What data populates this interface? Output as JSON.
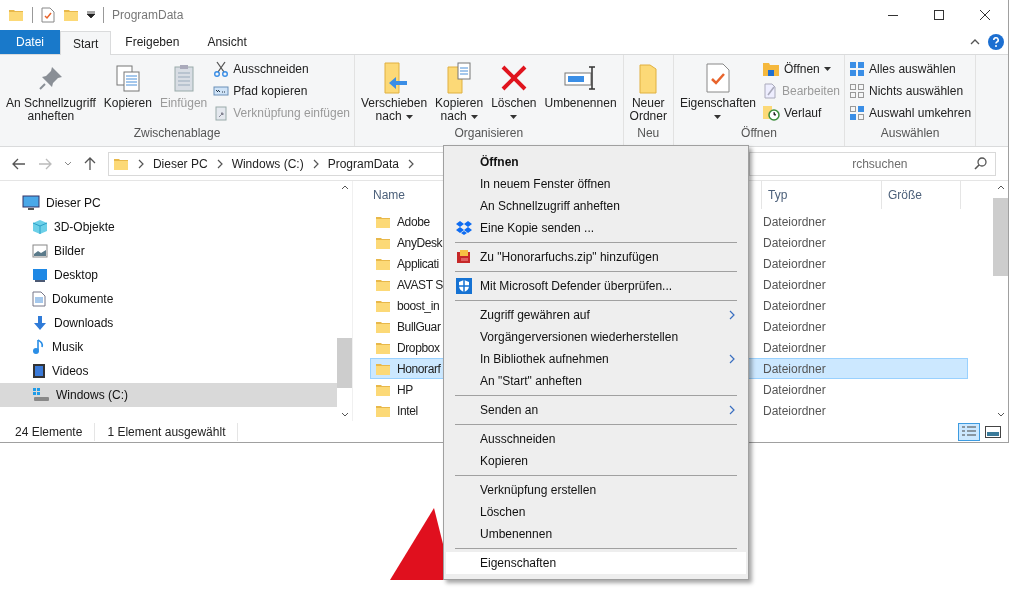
{
  "window": {
    "title": "ProgramData"
  },
  "ribbon_tabs": [
    {
      "label": "Datei",
      "selected": false,
      "kind": "file"
    },
    {
      "label": "Start",
      "selected": true,
      "kind": "tab"
    },
    {
      "label": "Freigeben",
      "selected": false,
      "kind": "tab"
    },
    {
      "label": "Ansicht",
      "selected": false,
      "kind": "tab"
    }
  ],
  "ribbon_groups": [
    {
      "label": "Zwischenablage",
      "large_buttons": [
        {
          "lines": [
            "An Schnellzugriff",
            "anheften"
          ],
          "disabled": false,
          "has_menu": false
        },
        {
          "lines": [
            "Kopieren"
          ],
          "disabled": false,
          "has_menu": false
        },
        {
          "lines": [
            "Einfügen"
          ],
          "disabled": true,
          "has_menu": false
        }
      ],
      "small_buttons": [
        {
          "label": "Ausschneiden",
          "disabled": false,
          "has_menu": false
        },
        {
          "label": "Pfad kopieren",
          "disabled": false,
          "has_menu": false
        },
        {
          "label": "Verknüpfung einfügen",
          "disabled": true,
          "has_menu": false
        }
      ]
    },
    {
      "label": "Organisieren",
      "large_buttons": [
        {
          "lines": [
            "Verschieben",
            "nach"
          ],
          "disabled": false,
          "has_menu": true
        },
        {
          "lines": [
            "Kopieren",
            "nach"
          ],
          "disabled": false,
          "has_menu": true
        },
        {
          "lines": [
            "Löschen"
          ],
          "disabled": false,
          "has_menu": true
        },
        {
          "lines": [
            "Umbenennen"
          ],
          "disabled": false,
          "has_menu": false
        }
      ]
    },
    {
      "label": "Neu",
      "large_buttons": [
        {
          "lines": [
            "Neuer",
            "Ordner"
          ],
          "disabled": false,
          "has_menu": false
        }
      ]
    },
    {
      "label": "Öffnen",
      "large_buttons": [
        {
          "lines": [
            "Eigenschaften"
          ],
          "disabled": false,
          "has_menu": true
        }
      ],
      "small_buttons": [
        {
          "label": "Öffnen",
          "disabled": false,
          "has_menu": true
        },
        {
          "label": "Bearbeiten",
          "disabled": true,
          "has_menu": false
        },
        {
          "label": "Verlauf",
          "disabled": false,
          "has_menu": false
        }
      ]
    },
    {
      "label": "Auswählen",
      "small_buttons": [
        {
          "label": "Alles auswählen",
          "disabled": false,
          "has_menu": false
        },
        {
          "label": "Nichts auswählen",
          "disabled": false,
          "has_menu": false
        },
        {
          "label": "Auswahl umkehren",
          "disabled": false,
          "has_menu": false
        }
      ]
    }
  ],
  "address_bar": {
    "path": [
      "Dieser PC",
      "Windows (C:)",
      "ProgramData"
    ]
  },
  "search": {
    "placeholder": "rchsuchen"
  },
  "nav_tree": [
    {
      "label": "Dieser PC",
      "selected": false,
      "children": [
        {
          "label": "3D-Objekte",
          "selected": false
        },
        {
          "label": "Bilder",
          "selected": false
        },
        {
          "label": "Desktop",
          "selected": false
        },
        {
          "label": "Dokumente",
          "selected": false
        },
        {
          "label": "Downloads",
          "selected": false
        },
        {
          "label": "Musik",
          "selected": false
        },
        {
          "label": "Videos",
          "selected": false
        },
        {
          "label": "Windows (C:)",
          "selected": true
        }
      ]
    }
  ],
  "file_list": {
    "columns": [
      "Name",
      "Typ",
      "Größe"
    ],
    "rows": [
      {
        "name": "Adobe",
        "type": "Dateiordner",
        "selected": false
      },
      {
        "name": "AnyDesk",
        "type": "Dateiordner",
        "selected": false
      },
      {
        "name": "Applicati",
        "type": "Dateiordner",
        "selected": false
      },
      {
        "name": "AVAST S",
        "type": "Dateiordner",
        "selected": false
      },
      {
        "name": "boost_in",
        "type": "Dateiordner",
        "selected": false
      },
      {
        "name": "BullGuar",
        "type": "Dateiordner",
        "selected": false
      },
      {
        "name": "Dropbox",
        "type": "Dateiordner",
        "selected": false
      },
      {
        "name": "Honorarf",
        "type": "Dateiordner",
        "selected": true
      },
      {
        "name": "HP",
        "type": "Dateiordner",
        "selected": false
      },
      {
        "name": "Intel",
        "type": "Dateiordner",
        "selected": false
      }
    ]
  },
  "status_bar": {
    "count": "24 Elemente",
    "selection": "1 Element ausgewählt"
  },
  "view_buttons": [
    {
      "selected": true
    },
    {
      "selected": false
    }
  ],
  "context_menu": {
    "sections": [
      [
        {
          "label": "Öffnen",
          "default": true,
          "has_submenu": false,
          "selected": false
        },
        {
          "label": "In neuem Fenster öffnen",
          "default": false,
          "has_submenu": false,
          "selected": false
        },
        {
          "label": "An Schnellzugriff anheften",
          "default": false,
          "has_submenu": false,
          "selected": false
        },
        {
          "label": "Eine Kopie senden ...",
          "default": false,
          "has_submenu": false,
          "selected": false
        }
      ],
      [
        {
          "label": "Zu \"Honorarfuchs.zip\" hinzufügen",
          "default": false,
          "has_submenu": false,
          "selected": false
        }
      ],
      [
        {
          "label": "Mit Microsoft Defender überprüfen...",
          "default": false,
          "has_submenu": false,
          "selected": false
        }
      ],
      [
        {
          "label": "Zugriff gewähren auf",
          "default": false,
          "has_submenu": true,
          "selected": false
        },
        {
          "label": "Vorgängerversionen wiederherstellen",
          "default": false,
          "has_submenu": false,
          "selected": false
        },
        {
          "label": "In Bibliothek aufnehmen",
          "default": false,
          "has_submenu": true,
          "selected": false
        },
        {
          "label": "An \"Start\" anheften",
          "default": false,
          "has_submenu": false,
          "selected": false
        }
      ],
      [
        {
          "label": "Senden an",
          "default": false,
          "has_submenu": true,
          "selected": false
        }
      ],
      [
        {
          "label": "Ausschneiden",
          "default": false,
          "has_submenu": false,
          "selected": false
        },
        {
          "label": "Kopieren",
          "default": false,
          "has_submenu": false,
          "selected": false
        }
      ],
      [
        {
          "label": "Verknüpfung erstellen",
          "default": false,
          "has_submenu": false,
          "selected": false
        },
        {
          "label": "Löschen",
          "default": false,
          "has_submenu": false,
          "selected": false
        },
        {
          "label": "Umbenennen",
          "default": false,
          "has_submenu": false,
          "selected": false
        }
      ],
      [
        {
          "label": "Eigenschaften",
          "default": false,
          "has_submenu": false,
          "selected": true
        }
      ]
    ]
  }
}
